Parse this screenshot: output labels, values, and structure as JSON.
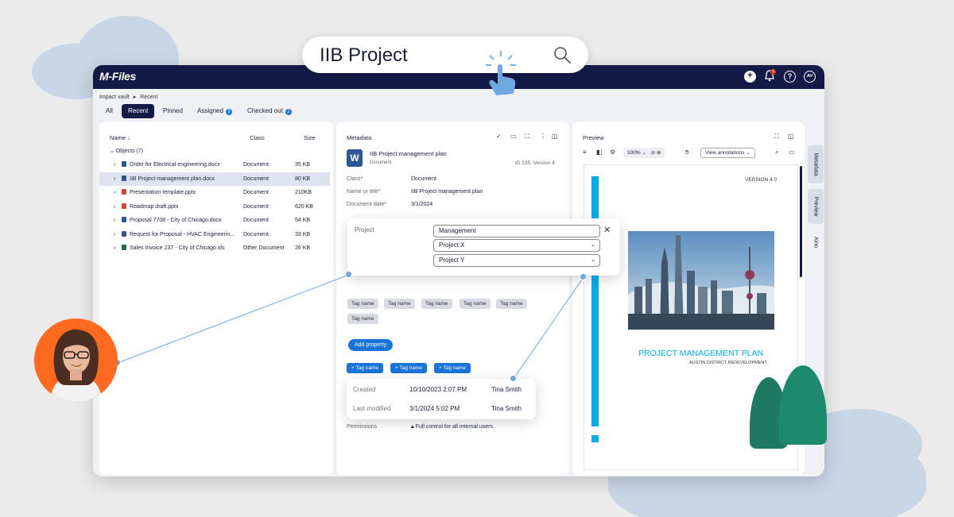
{
  "search": {
    "query": "IIB Project"
  },
  "app": {
    "logo": "M-Files",
    "notif_count": "1",
    "avatar_initials": "AV"
  },
  "breadcrumb": {
    "vault": "Impact vault",
    "current": "Recent"
  },
  "tabs": [
    {
      "label": "All"
    },
    {
      "label": "Recent"
    },
    {
      "label": "Pinned"
    },
    {
      "label": "Assigned",
      "badge": "3"
    },
    {
      "label": "Checked out",
      "badge": "2"
    }
  ],
  "list": {
    "col_name": "Name",
    "col_class": "Class",
    "col_size": "Size",
    "group": "Objects (7)",
    "rows": [
      {
        "name": "Order for Electrical engineering.docx",
        "class": "Document",
        "size": "35 KB",
        "type": "docx"
      },
      {
        "name": "IIB Project management plan.docx",
        "class": "Document",
        "size": "80 KB",
        "type": "docx"
      },
      {
        "name": "Presentation template.pptx",
        "class": "Document",
        "size": "210KB",
        "type": "pptx"
      },
      {
        "name": "Roadmap draft.pptx",
        "class": "Document",
        "size": "620 KB",
        "type": "pptx"
      },
      {
        "name": "Proposal 7708 - City of Chicago.docx",
        "class": "Document",
        "size": "54 KB",
        "type": "docx"
      },
      {
        "name": "Request for Proposal - HVAC Engineerin...",
        "class": "Document",
        "size": "33 KB",
        "type": "docx"
      },
      {
        "name": "Sales Invoice 237 - City of Chicago.xls",
        "class": "Other Document",
        "size": "26 KB",
        "type": "xls"
      }
    ]
  },
  "metadata": {
    "title": "Metadata",
    "doc_title": "IIB Project management plan",
    "doc_subtitle": "Document",
    "doc_id": "ID 235, Version 4",
    "fields": [
      {
        "label": "Class*",
        "value": "Document"
      },
      {
        "label": "Name or title*",
        "value": "IIB Project management plan"
      },
      {
        "label": "Document date*",
        "value": "3/1/2024"
      }
    ],
    "project_label": "Project",
    "project_values": [
      "Management",
      "Project X",
      "Project Y"
    ],
    "tags": [
      "Tag name",
      "Tag name",
      "Tag name",
      "Tag name",
      "Tag name",
      "Tag name"
    ],
    "add_property": "Add property",
    "blue_tags": [
      "+ Tag name",
      "+ Tag name",
      "+ Tag name"
    ],
    "created_label": "Created",
    "created_date": "10/10/2023 2:07 PM",
    "created_by": "Tina Smith",
    "modified_label": "Last modified",
    "modified_date": "3/1/2024 5:02 PM",
    "modified_by": "Tina Smith",
    "permissions_label": "Permissions",
    "permissions_value": "Full control for all internal users"
  },
  "preview": {
    "title": "Preview",
    "zoom": "100%",
    "view_annotations": "View annotations",
    "version": "VERSION 4.0",
    "doc_heading": "PROJECT MANAGEMENT PLAN",
    "doc_subheading": "AUSTIN DISTRICT REDEVELOPMENT"
  },
  "side_tabs": [
    "Metadata",
    "Preview",
    "Aino"
  ],
  "colors": {
    "navy": "#131a45",
    "accent": "#1a73d9",
    "cyan": "#00aeef"
  }
}
